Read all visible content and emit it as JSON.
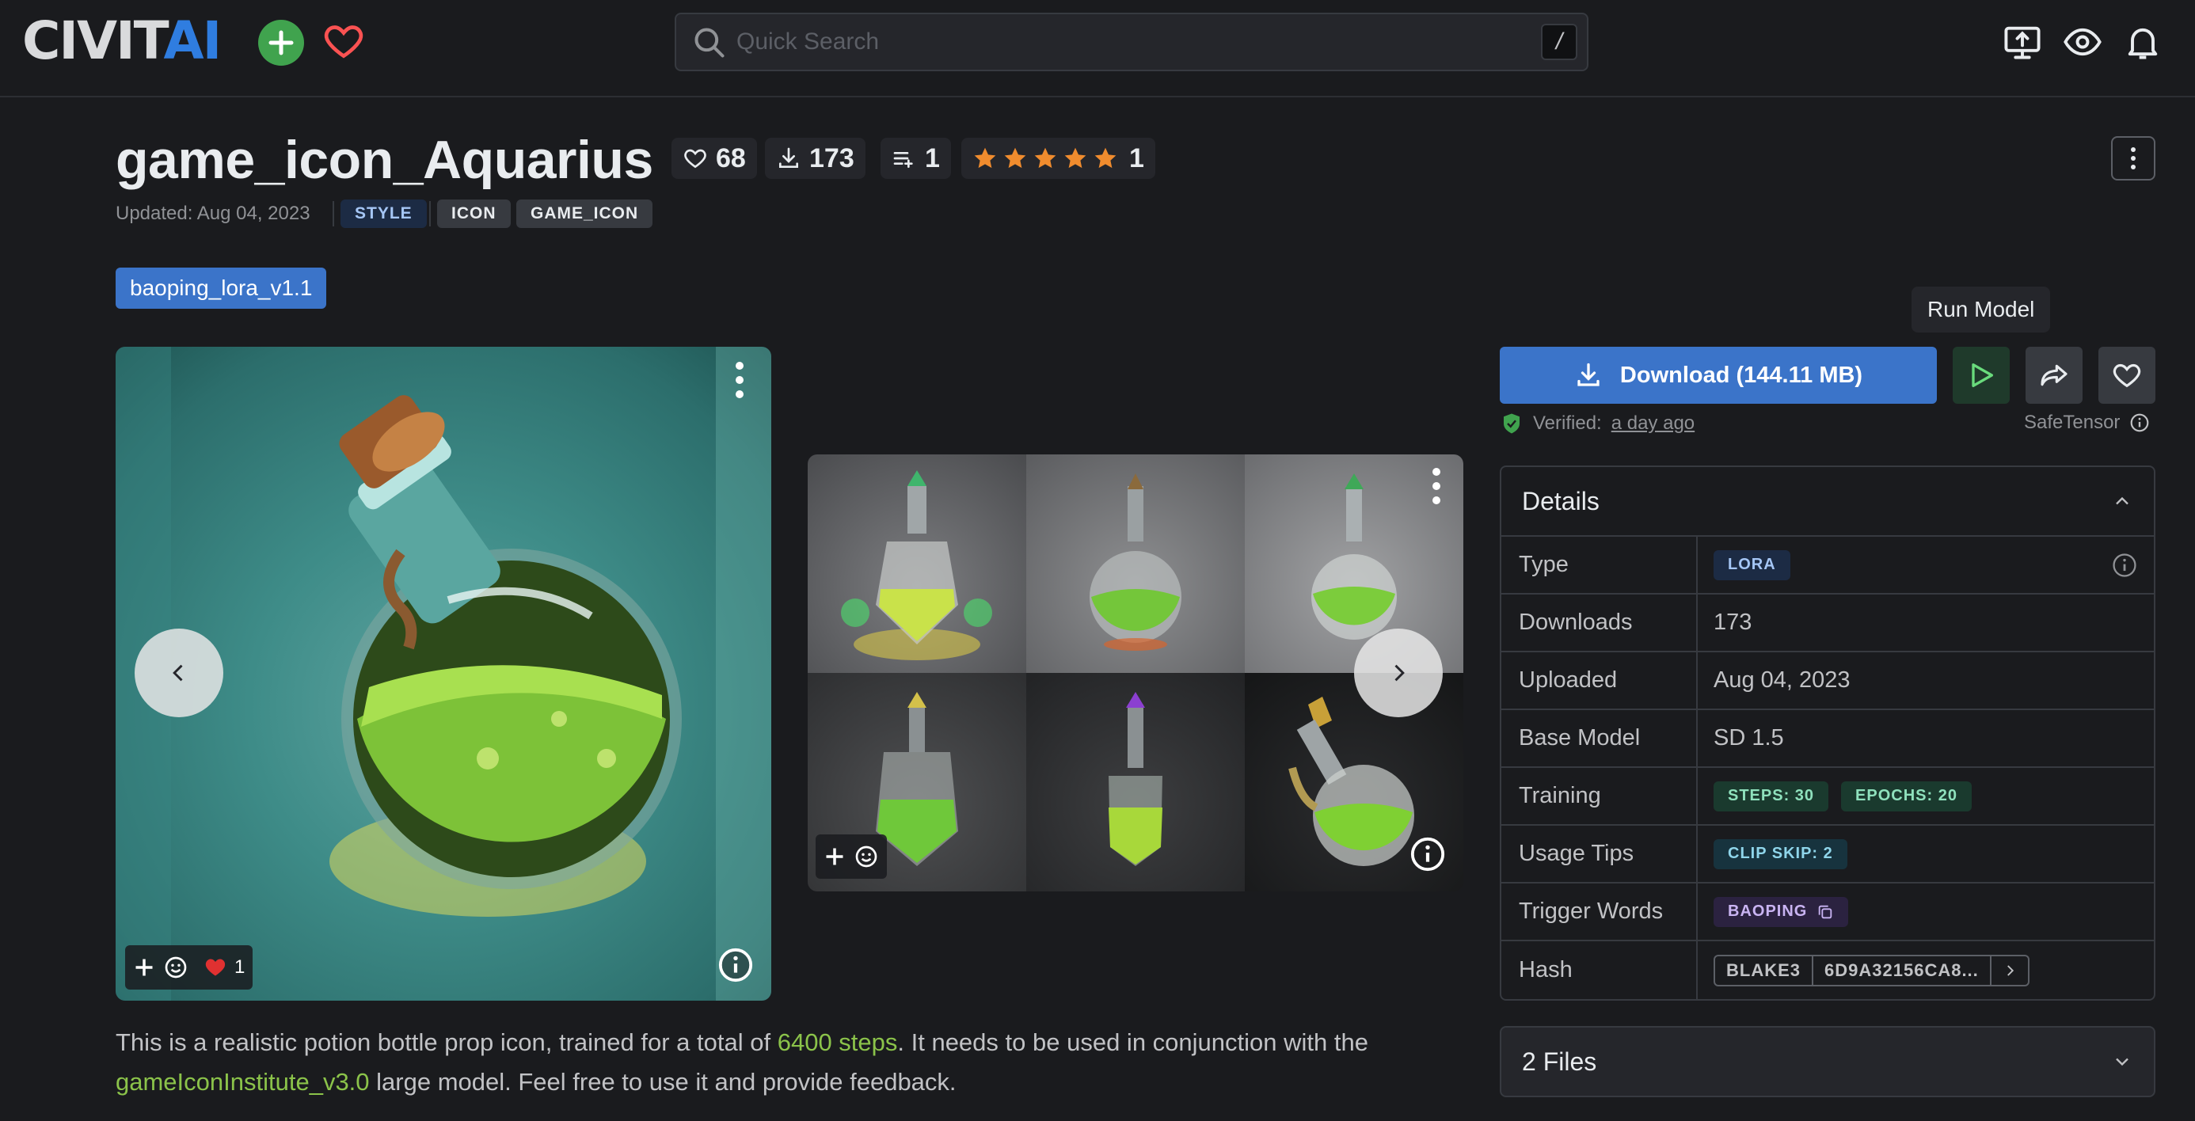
{
  "header": {
    "logo_civit": "CIVIT",
    "logo_ai": "AI",
    "search_placeholder": "Quick Search",
    "search_shortcut": "/"
  },
  "model": {
    "title": "game_icon_Aquarius",
    "likes": "68",
    "downloads": "173",
    "collections": "1",
    "rating_count": "1",
    "rating_stars": 5,
    "updated": "Updated: Aug 04, 2023",
    "tags": [
      "STYLE",
      "ICON",
      "GAME_ICON"
    ],
    "version": "baoping_lora_v1.1"
  },
  "main_image": {
    "reaction_count": "1"
  },
  "description": {
    "part1": "This is a realistic potion bottle prop icon, trained for a total of ",
    "link1": "6400 steps",
    "part2": ". It needs to be used in conjunction with the ",
    "link2": "gameIconInstitute_v3.0",
    "part3": " large model. Feel free to use it and provide feedback."
  },
  "side": {
    "run_tooltip": "Run Model",
    "download_label": "Download (144.11 MB)",
    "verified_label": "Verified:",
    "verified_when": "a day ago",
    "safetensor": "SafeTensor",
    "details_title": "Details",
    "files_label": "2 Files"
  },
  "details": {
    "type_key": "Type",
    "type_val": "LORA",
    "downloads_key": "Downloads",
    "downloads_val": "173",
    "uploaded_key": "Uploaded",
    "uploaded_val": "Aug 04, 2023",
    "base_key": "Base Model",
    "base_val": "SD 1.5",
    "training_key": "Training",
    "steps": "STEPS: 30",
    "epochs": "EPOCHS: 20",
    "usage_key": "Usage Tips",
    "clip_skip": "CLIP SKIP: 2",
    "trigger_key": "Trigger Words",
    "trigger_val": "BAOPING",
    "hash_key": "Hash",
    "hash_algo": "BLAKE3",
    "hash_val": "6D9A32156CA8..."
  },
  "colors": {
    "background": "#1a1b1e",
    "accent_blue": "#3b74c9",
    "link_green": "#8bc34a",
    "star": "#f08c2e"
  }
}
